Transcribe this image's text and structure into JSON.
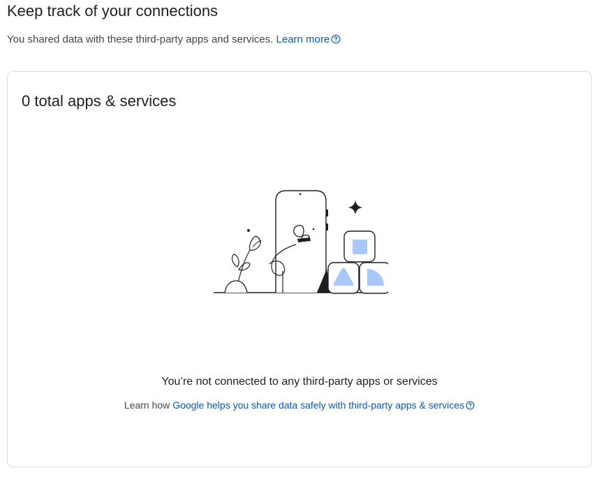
{
  "header": {
    "title": "Keep track of your connections",
    "intro_text": "You shared data with these third-party apps and services. ",
    "learn_more_label": "Learn more"
  },
  "card": {
    "title": "0 total apps & services",
    "empty_title": "You’re not connected to any third-party apps or services",
    "empty_sub_prefix": "Learn how ",
    "empty_sub_link": "Google helps you share data safely with third-party apps & services"
  },
  "icons": {
    "help": "help-circle-icon",
    "illustration": "empty-state-phone-blocks-illustration"
  },
  "colors": {
    "link": "#0b57d0",
    "illustration_accent": "#a8c7fa",
    "border": "#dadce0"
  }
}
